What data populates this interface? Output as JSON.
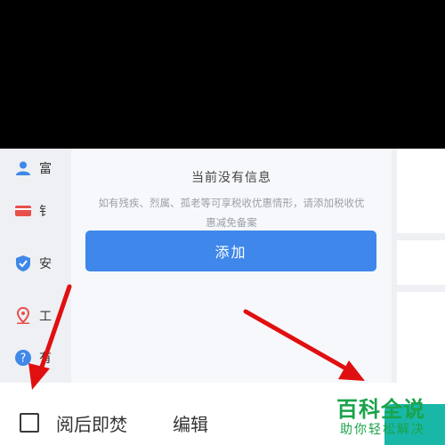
{
  "empty_state": {
    "title": "当前没有信息",
    "description": "如有残疾、烈属、孤老等可享税收优惠情形，请添加税收优惠减免备案",
    "add_button_label": "添加"
  },
  "sidebar": {
    "items": [
      {
        "icon": "user-icon",
        "label": "富",
        "color": "#3f87ea"
      },
      {
        "icon": "card-icon",
        "label": "钅",
        "color": "#e8504a"
      },
      {
        "icon": "shield-check-icon",
        "label": "安",
        "color": "#3f87ea"
      },
      {
        "icon": "location-pin-icon",
        "label": "工",
        "color": "#e8504a"
      },
      {
        "icon": "help-icon",
        "label": "有",
        "color": "#3f87ea"
      }
    ]
  },
  "bottom_bar": {
    "burn_after_reading_label": "阅后即焚",
    "edit_label": "编辑"
  },
  "watermark": {
    "main": "百科全说",
    "sub": "助你轻松解决"
  },
  "colors": {
    "accent": "#3f87ea",
    "annotation_arrow": "#e01010",
    "watermark_green": "#1aa34a"
  }
}
